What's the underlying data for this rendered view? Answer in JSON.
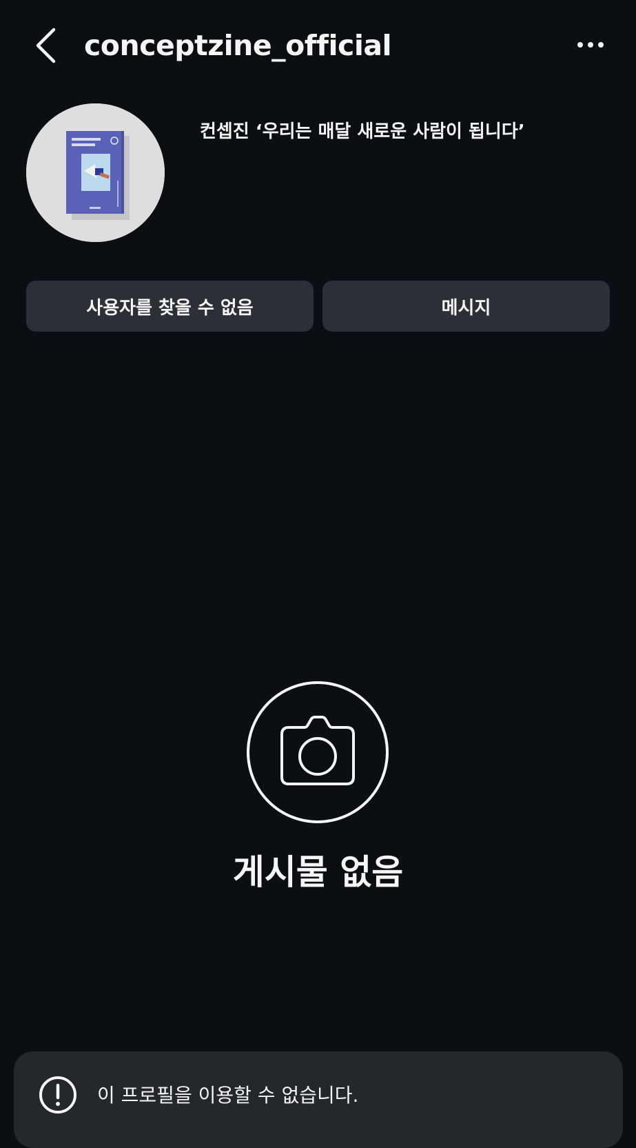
{
  "header": {
    "back_icon": "chevron-left-icon",
    "username": "conceptzine_official",
    "more_icon": "more-horizontal-icon"
  },
  "profile": {
    "bio": "컨셉진 ‘우리는 매달 새로운 사람이 됩니다’"
  },
  "actions": {
    "user_not_found_label": "사용자를 찾을 수 없음",
    "message_label": "메시지"
  },
  "posts": {
    "empty_icon": "camera-icon",
    "empty_title": "게시물 없음"
  },
  "toast": {
    "icon": "alert-circle-icon",
    "message": "이 프로필을 이용할 수 없습니다."
  },
  "colors": {
    "background": "#0b0f13",
    "button_bg": "#2c3036",
    "toast_bg": "#24272b",
    "text": "#f5f5f5"
  }
}
